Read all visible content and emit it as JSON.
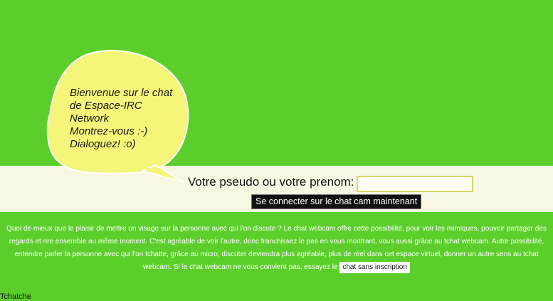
{
  "bubble": {
    "lines": [
      "Bienvenue sur le chat",
      "de Espace-IRC",
      "Network",
      "Montrez-vous :-)",
      "Dialoguez! :o)"
    ]
  },
  "login": {
    "label": "Votre pseudo ou votre prenom:",
    "input_value": "",
    "button_label": "Se connecter sur le chat cam maintenant"
  },
  "description": {
    "lines": [
      "Quoi de mieux que le plaisir de mettre un visage sur la personne avec qui l'on discute ? Le chat webcam offre cette possibilité, pour voir les mimiques, pouvoir partager des",
      "regards et rire ensemble au même moment. C'est agréable de voir l'autre, donc franchissez le pas en vous montrant, vous aussi grâce au tchat webcam. Autre possibilité,",
      "entendre parler la personne avec qui l'on tchatte, grâce au micro, discuter deviendra plus agréable, plus de réel dans cet espace virtuel, donner un autre sens au tchat"
    ],
    "last_line_prefix": "webcam. Si le chat webcam ne vous convient pas, essayez le",
    "link_label": "chat sans inscription"
  },
  "footer": {
    "text": "Tchatche"
  },
  "colors": {
    "background": "#5cce2b",
    "band": "#f7f7e4",
    "bubble_fill": "#f5f57a",
    "button_bg": "#111111"
  }
}
